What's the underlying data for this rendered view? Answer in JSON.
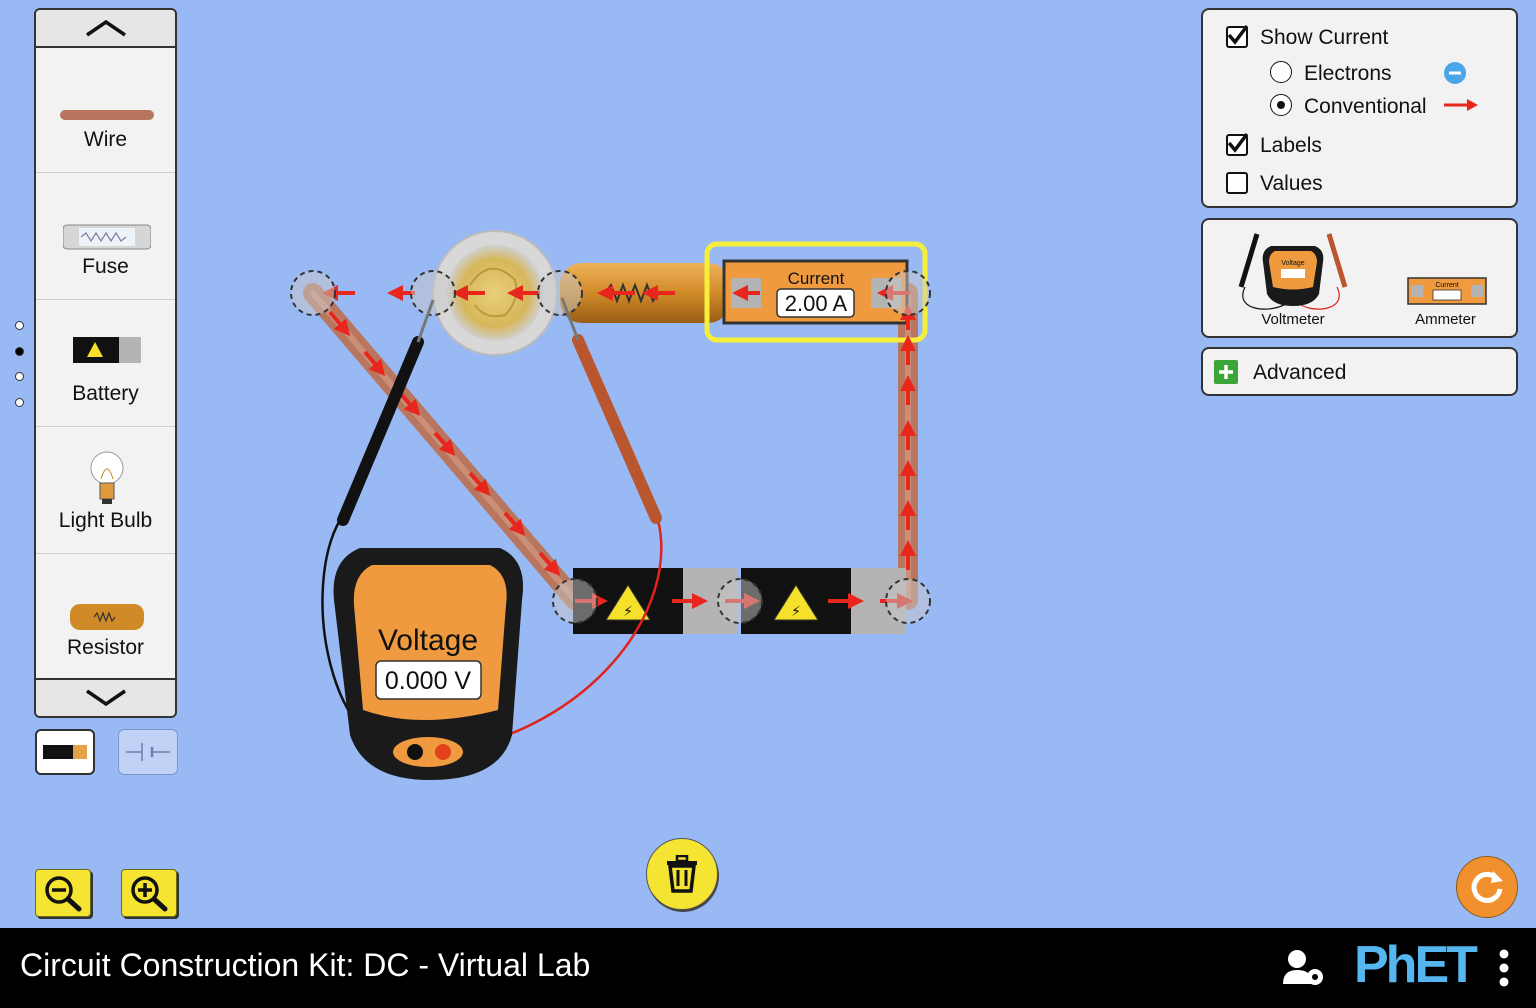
{
  "app": {
    "title": "Circuit Construction Kit: DC - Virtual Lab",
    "logo": "PhET"
  },
  "toolbox": {
    "items": [
      {
        "label": "Wire",
        "icon": "wire-icon"
      },
      {
        "label": "Fuse",
        "icon": "fuse-icon"
      },
      {
        "label": "Battery",
        "icon": "battery-icon"
      },
      {
        "label": "Light Bulb",
        "icon": "light-bulb-icon"
      },
      {
        "label": "Resistor",
        "icon": "resistor-icon"
      }
    ],
    "pages": 4,
    "active_page": 2,
    "view_modes": [
      "lifelike",
      "schematic"
    ],
    "selected_view": "lifelike"
  },
  "controls": {
    "show_current": {
      "label": "Show Current",
      "checked": true
    },
    "electrons": {
      "label": "Electrons",
      "selected": false
    },
    "conventional": {
      "label": "Conventional",
      "selected": true
    },
    "labels": {
      "label": "Labels",
      "checked": true
    },
    "values": {
      "label": "Values",
      "checked": false
    }
  },
  "sensor_toolbox": {
    "voltmeter_label": "Voltmeter",
    "voltmeter_icon_text": "Voltage",
    "ammeter_label": "Ammeter",
    "ammeter_icon_text": "Current"
  },
  "advanced": {
    "label": "Advanced"
  },
  "ammeter": {
    "title": "Current",
    "reading": "2.00 A"
  },
  "voltmeter": {
    "title": "Voltage",
    "reading": "0.000 V"
  },
  "colors": {
    "background": "#99b9f5",
    "highlight": "#f5ef3a",
    "meter_orange": "#ef9a3e",
    "current_arrow": "#e8261d",
    "electron_blue": "#4aa6e8",
    "advanced_green": "#3aa63a"
  }
}
